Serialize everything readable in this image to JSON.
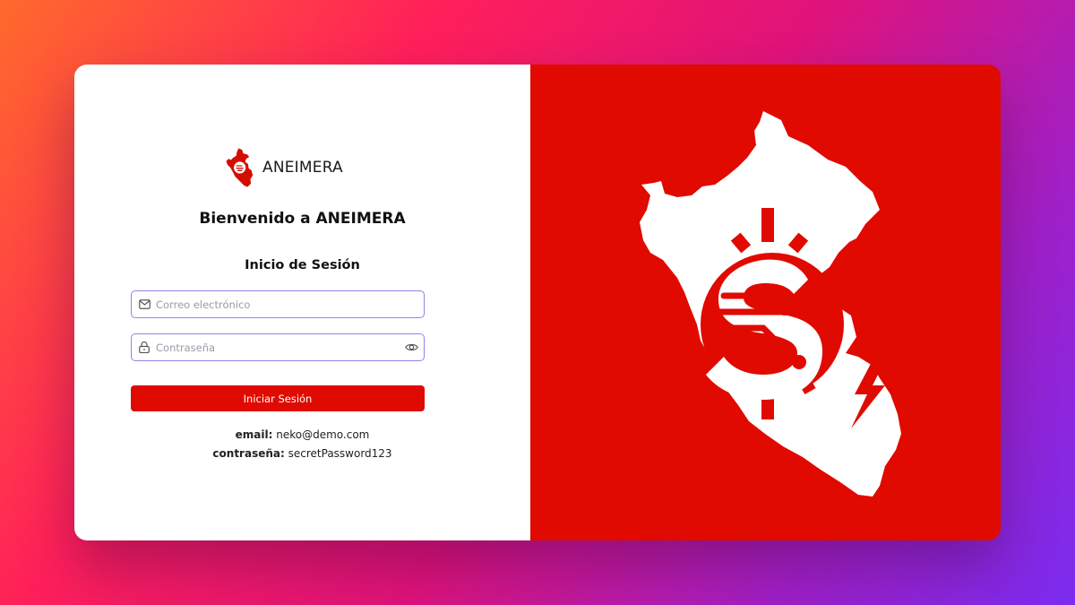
{
  "brand": {
    "name": "ANEIMERA"
  },
  "login": {
    "welcome": "Bienvenido a ANEIMERA",
    "subtitle": "Inicio de Sesión",
    "email_placeholder": "Correo electrónico",
    "password_placeholder": "Contraseña",
    "submit_label": "Iniciar Sesión"
  },
  "demo": {
    "email_label": "email:",
    "email_value": "neko@demo.com",
    "password_label": "contraseña:",
    "password_value": "secretPassword123"
  },
  "colors": {
    "accent": "#e00a00",
    "input_border": "#8a86e8",
    "background_gradient": [
      "#ff6a2c",
      "#ff1f5a",
      "#e0137a",
      "#a020c8",
      "#7a2cf0"
    ]
  },
  "icons": {
    "email": "mail-icon",
    "password": "lock-icon",
    "toggle": "eye-icon",
    "logo": "peru-map-circuit-logo"
  }
}
